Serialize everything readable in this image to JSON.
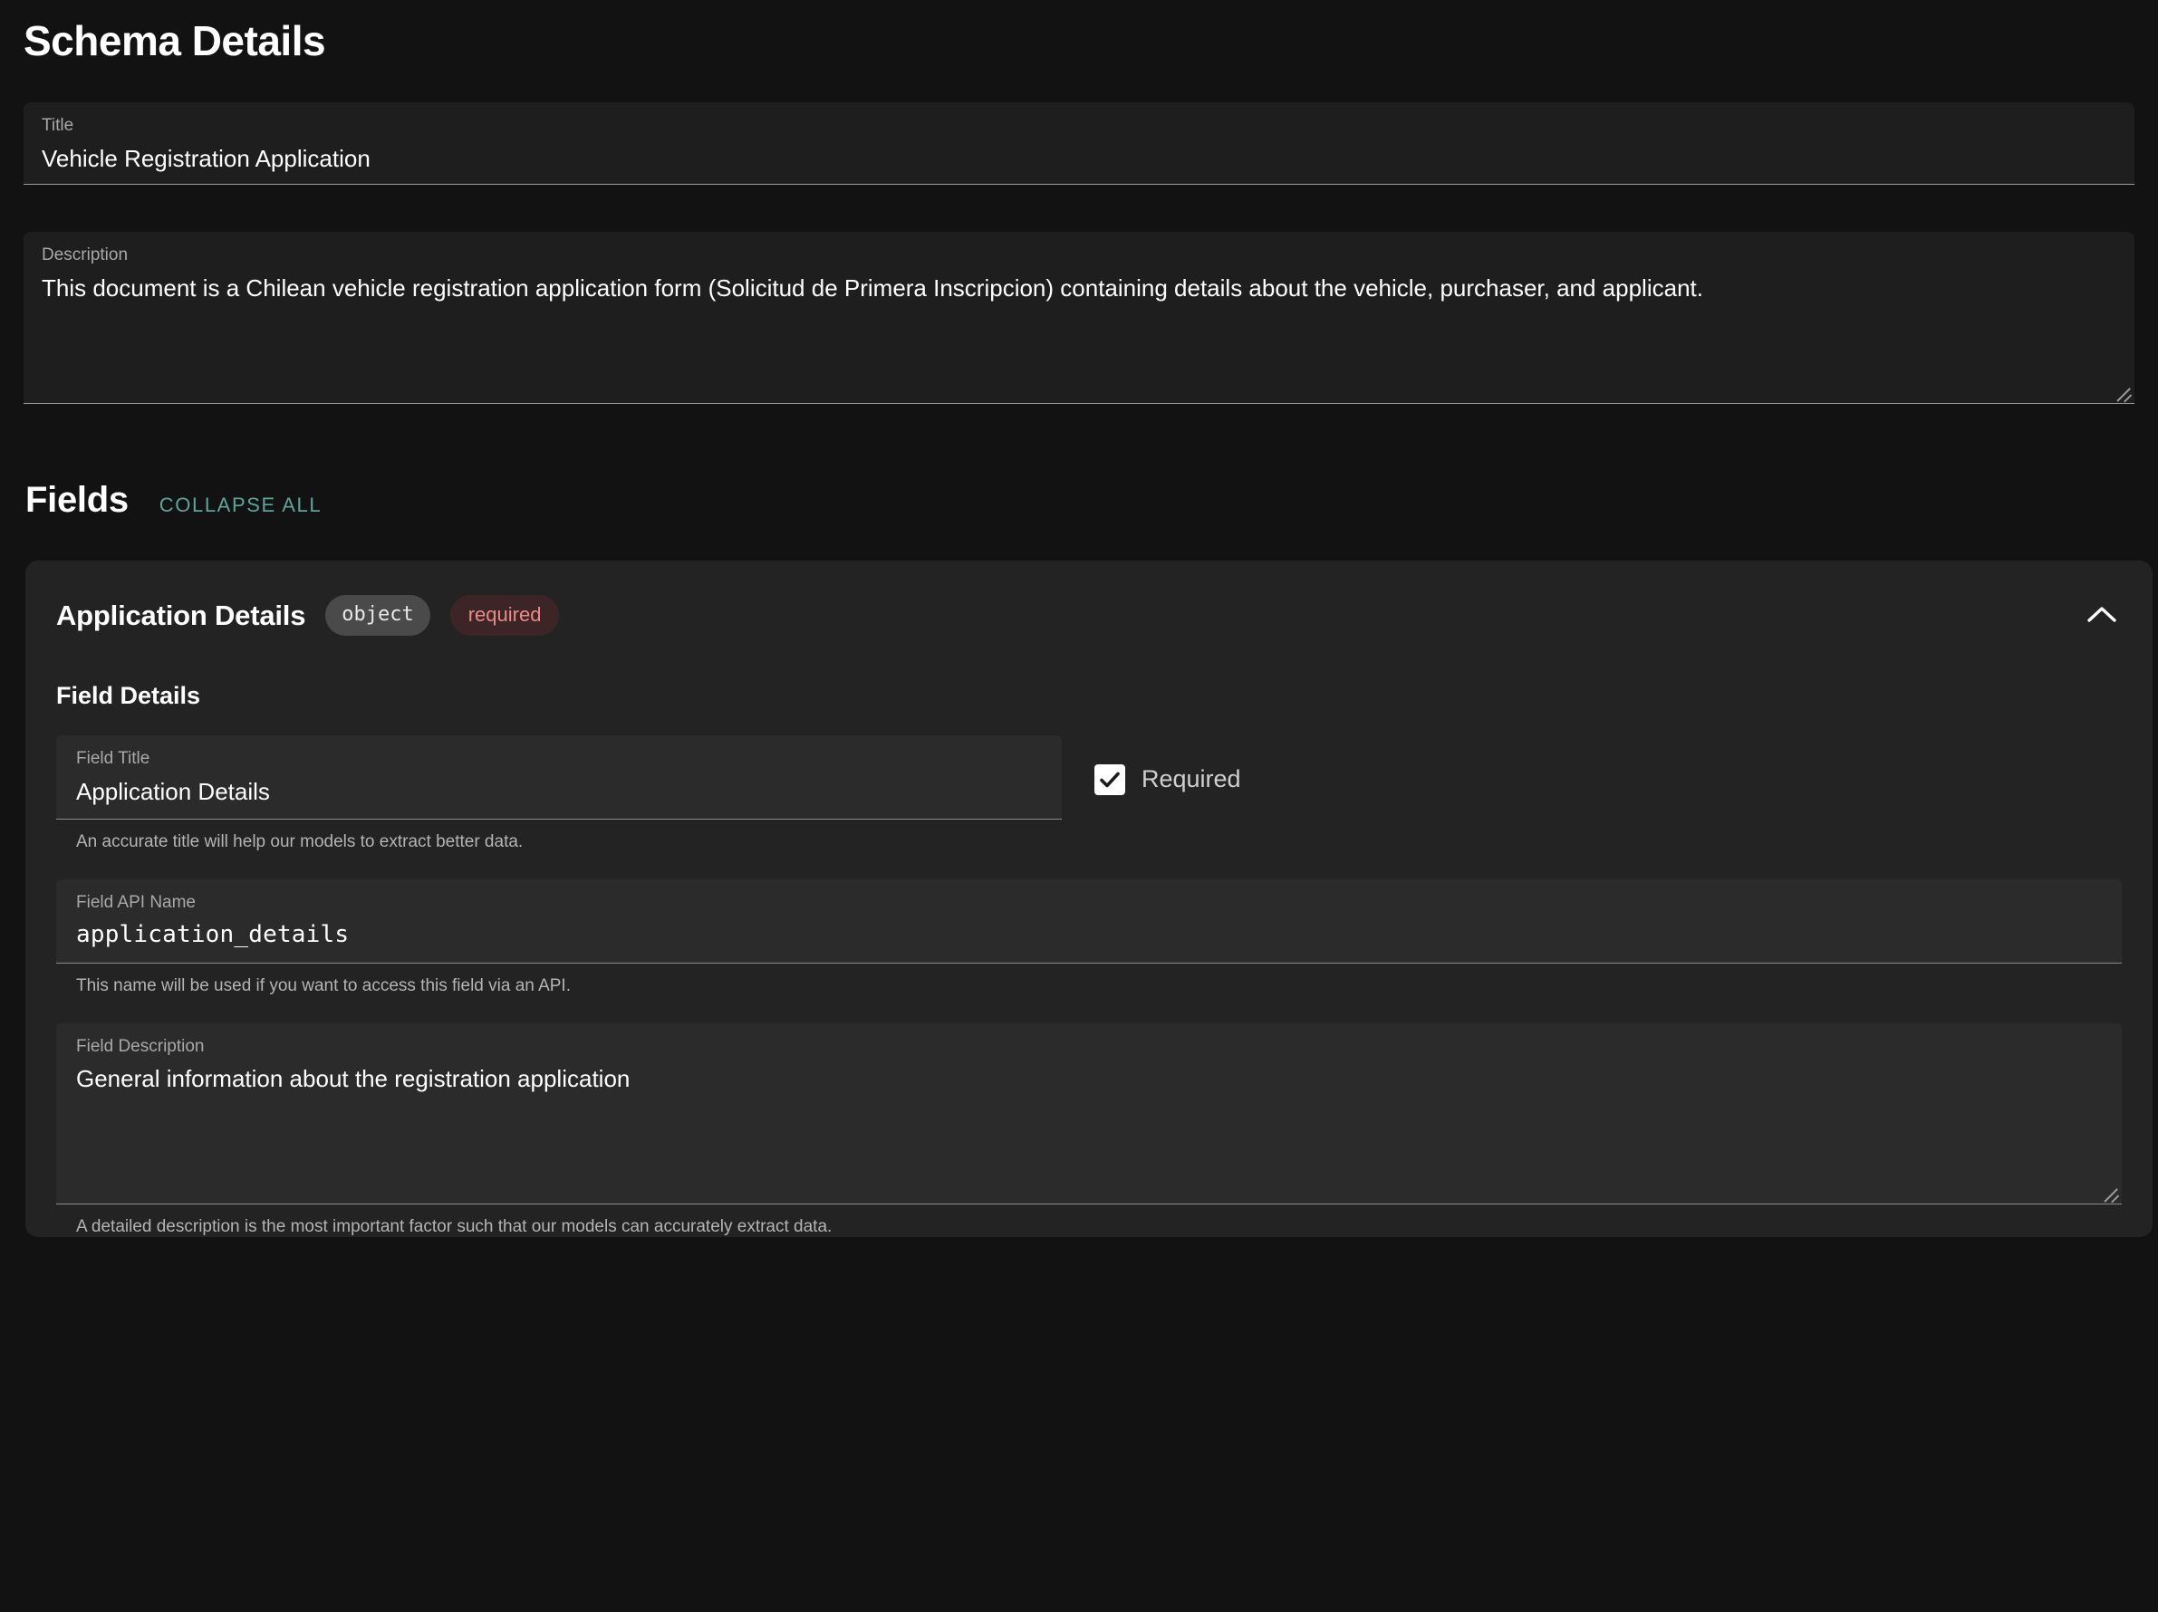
{
  "page": {
    "title": "Schema Details"
  },
  "schema": {
    "title_label": "Title",
    "title_value": "Vehicle Registration Application",
    "description_label": "Description",
    "description_value": "This document is a Chilean vehicle registration application form (Solicitud de Primera Inscripcion) containing details about the vehicle, purchaser, and applicant."
  },
  "fields_section": {
    "heading": "Fields",
    "collapse_all_label": "COLLAPSE ALL",
    "collapse_all_color": "#5fa49b"
  },
  "field_card": {
    "name": "Application Details",
    "type_badge": "object",
    "required_badge": "required",
    "required_badge_color": "#e98a88",
    "collapse_icon": "chevron-up-icon",
    "section_heading": "Field Details",
    "field_title_label": "Field Title",
    "field_title_value": "Application Details",
    "field_title_helper": "An accurate title will help our models to extract better data.",
    "required_checkbox_label": "Required",
    "required_checkbox_checked": true,
    "api_name_label": "Field API Name",
    "api_name_value": "application_details",
    "api_name_helper": "This name will be used if you want to access this field via an API.",
    "description_label": "Field Description",
    "description_value": "General information about the registration application",
    "description_helper": "A detailed description is the most important factor such that our models can accurately extract data."
  }
}
